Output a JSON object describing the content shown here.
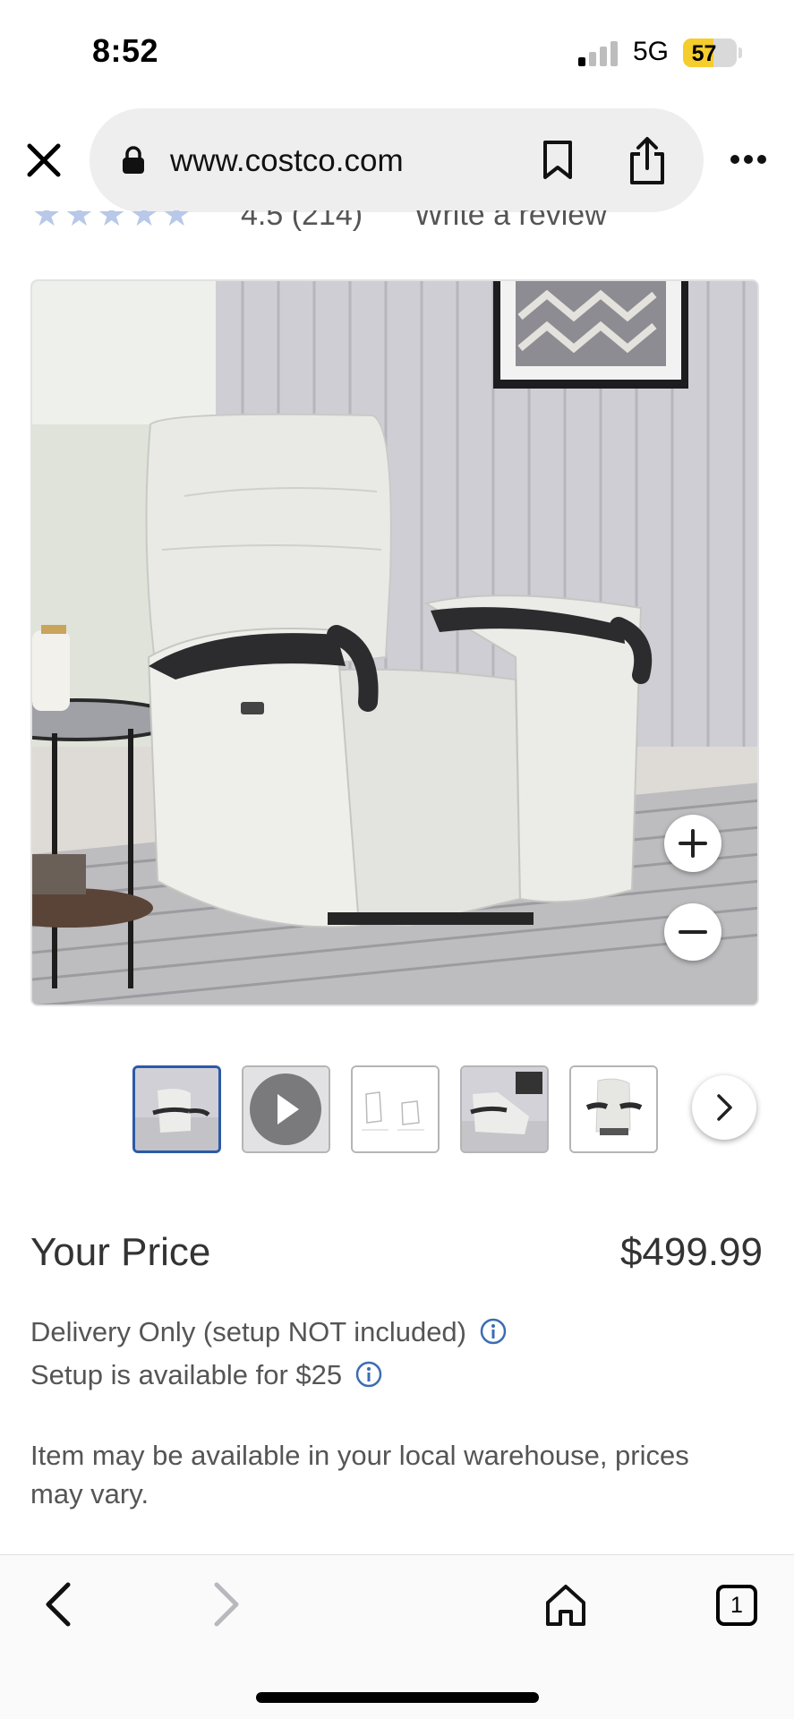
{
  "status_bar": {
    "time": "8:52",
    "network": "5G",
    "battery_level": "57",
    "battery_fraction": 0.57
  },
  "browser": {
    "url": "www.costco.com",
    "tab_count": "1"
  },
  "rating": {
    "stars": "★★★★★",
    "score_partial": "4.5 (214)",
    "write_review": "Write a review"
  },
  "product_image": {
    "alt": "White leather power recliner with black wooden armrests"
  },
  "thumbnails": [
    {
      "name": "thumb-recliner-living-room",
      "active": true
    },
    {
      "name": "thumb-video",
      "active": false
    },
    {
      "name": "thumb-dimensions-drawing",
      "active": false
    },
    {
      "name": "thumb-recliner-reclined",
      "active": false
    },
    {
      "name": "thumb-recliner-front",
      "active": false
    }
  ],
  "pricing": {
    "label": "Your Price",
    "price": "$499.99",
    "delivery_note": "Delivery Only (setup NOT included)",
    "setup_note": "Setup is available for $25",
    "availability_note": "Item may be available in your local warehouse, prices may vary."
  },
  "colors": {
    "accent": "#2b5aa6",
    "info_icon": "#3b6db3",
    "battery": "#f5cd2c"
  }
}
